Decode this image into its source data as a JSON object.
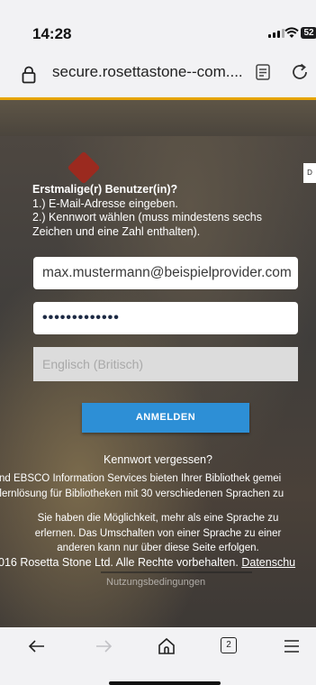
{
  "status_bar": {
    "time": "14:28",
    "battery": "52"
  },
  "browser": {
    "url": "secure.rosettastone--com...."
  },
  "page": {
    "side_tab": "D",
    "first_time": {
      "heading": "Erstmalige(r) Benutzer(in)?",
      "step1": "1.) E-Mail-Adresse eingeben.",
      "step2": "2.) Kennwort wählen (muss mindestens sechs Zeichen und eine Zahl enthalten)."
    },
    "email": {
      "value": "max.mustermann@beispielprovider.com"
    },
    "password": {
      "value": "•••••••••••••"
    },
    "language": {
      "placeholder": "Englisch (Britisch)"
    },
    "login_button": "ANMELDEN",
    "forgot_password": "Kennwort vergessen?",
    "ebsco_line1": "nd EBSCO Information Services bieten Ihrer Bibliothek gemei",
    "ebsco_line2": "nlernlösung für Bibliotheken mit 30 verschiedenen Sprachen zu",
    "choose_text": "Sie haben die Möglichkeit, mehr als eine Sprache zu erlernen. Das Umschalten von einer Sprache zu einer anderen kann nur über diese Seite erfolgen.",
    "copyright": "016 Rosetta Stone Ltd. Alle Rechte vorbehalten.",
    "privacy_link": "Datenschu",
    "terms_link": "Nutzungsbedingungen"
  },
  "toolbar": {
    "tab_count": "2"
  }
}
